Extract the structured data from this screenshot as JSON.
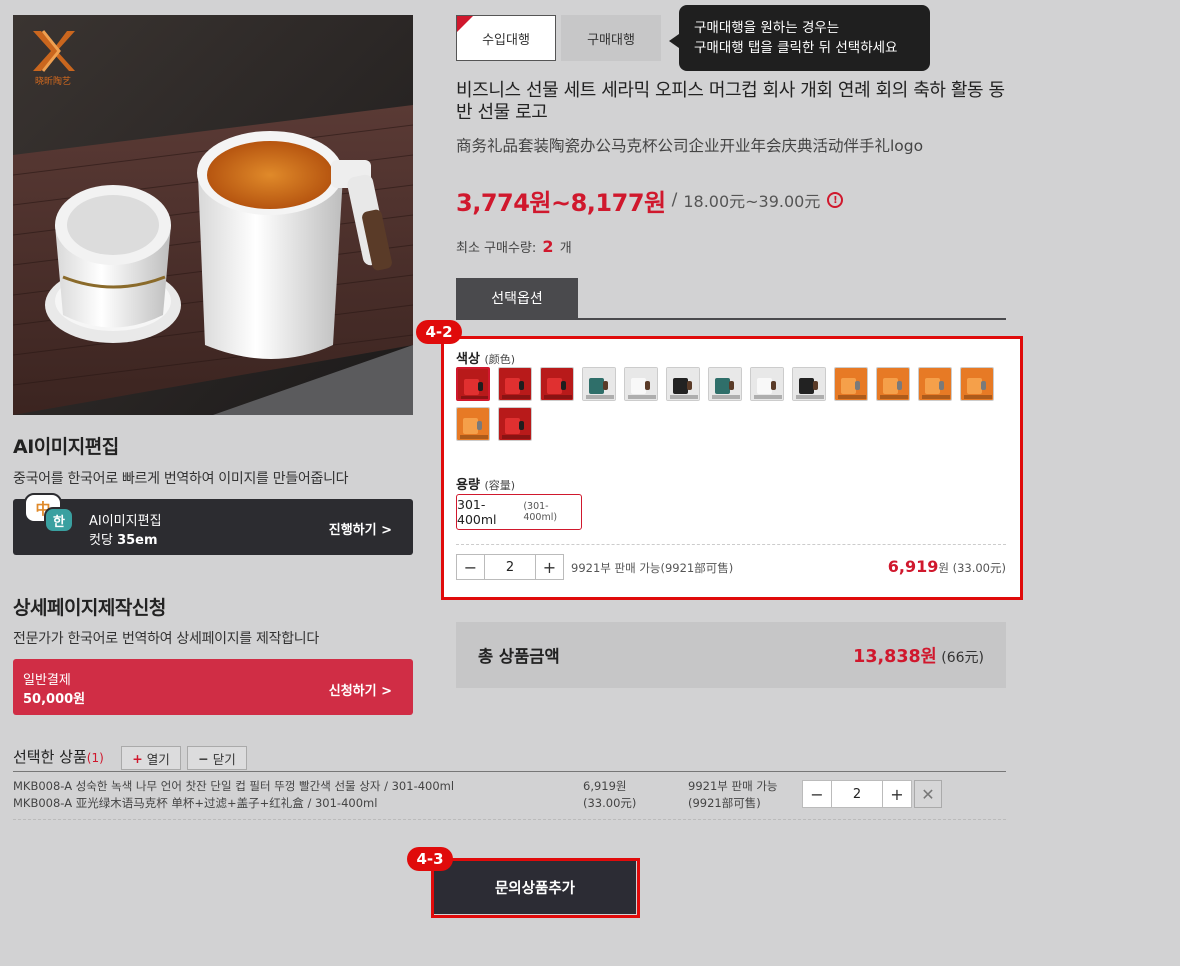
{
  "left": {
    "logo_text": "晓昕陶艺",
    "ai_edit": {
      "title": "AI이미지편집",
      "desc": "중국어를 한국어로 빠르게 번역하여 이미지를 만들어줍니다",
      "badge_zh": "中",
      "badge_ko": "한",
      "box_title": "AI이미지편집",
      "box_unit": "컷당",
      "box_price": "35em",
      "cta": "진행하기 >"
    },
    "detail_page": {
      "title": "상세페이지제작신청",
      "desc": "전문가가 한국어로 번역하여 상세페이지를 제작합니다",
      "box_title": "일반결제",
      "box_price": "50,000원",
      "cta": "신청하기 >"
    }
  },
  "tabs": {
    "import": "수입대행",
    "purchase": "구매대행",
    "tooltip_line1": "구매대행을 원하는 경우는",
    "tooltip_line2": "구매대행 탭을 클릭한 뒤 선택하세요"
  },
  "product": {
    "title": "비즈니스 선물 세트 세라믹 오피스 머그컵 회사 개회 연례 회의 축하 활동 동반 선물 로고",
    "title_cn": "商务礼品套装陶瓷办公马克杯公司企业开业年会庆典活动伴手礼logo",
    "price_krw": "3,774원~8,177원",
    "price_sep": "/",
    "price_cny": "18.00元~39.00元",
    "info_icon": "!",
    "min_order_label": "최소 구매수량:",
    "min_order_qty": "2",
    "min_order_unit": "개"
  },
  "options": {
    "tab_label": "선택옵션",
    "badge": "4-2",
    "color_label": "색상",
    "color_label_cn": "(颜色)",
    "swatches": [
      "red-gift",
      "red-gift",
      "red-gift",
      "green-mug",
      "white-mug",
      "black-mug",
      "green-mug",
      "white-mug",
      "black-mug",
      "orange-gift",
      "orange-gift",
      "orange-gift",
      "orange-gift",
      "orange-gift",
      "red-gift"
    ],
    "capacity_label": "용량",
    "capacity_label_cn": "(容量)",
    "capacity_value": "301-400ml",
    "capacity_value_cn": "(301-400ml)",
    "qty": "2",
    "minus": "−",
    "plus": "+",
    "stock": "9921부 판매 가능(9921部可售)",
    "line_price": "6,919",
    "line_price_unit": "원",
    "line_price_cny": "(33.00元)"
  },
  "total": {
    "label": "총 상품금액",
    "value": "13,838원",
    "value_cny": "(66元)"
  },
  "selected": {
    "title": "선택한 상품",
    "count": "(1)",
    "open_label": "열기",
    "close_label": "닫기",
    "open_icon": "+",
    "close_icon": "−",
    "item_name_ko": "MKB008-A 성숙한 녹색 나무 언어 찻잔 단일 컵 필터 뚜껑 빨간색 선물 상자 / 301-400ml",
    "item_name_cn": "MKB008-A 亚光绿木语马克杯 单杯+过滤+盖子+红礼盒 / 301-400ml",
    "price": "6,919원",
    "price_cny": "(33.00元)",
    "stock": "9921부 판매 가능",
    "stock_cn": "(9921部可售)",
    "qty": "2",
    "delete_icon": "✕"
  },
  "action": {
    "badge": "4-3",
    "add_label": "문의상품추가"
  },
  "colors": {
    "accent": "#d0182d",
    "highlight": "#e00b0b",
    "dark": "#2c2c30"
  }
}
